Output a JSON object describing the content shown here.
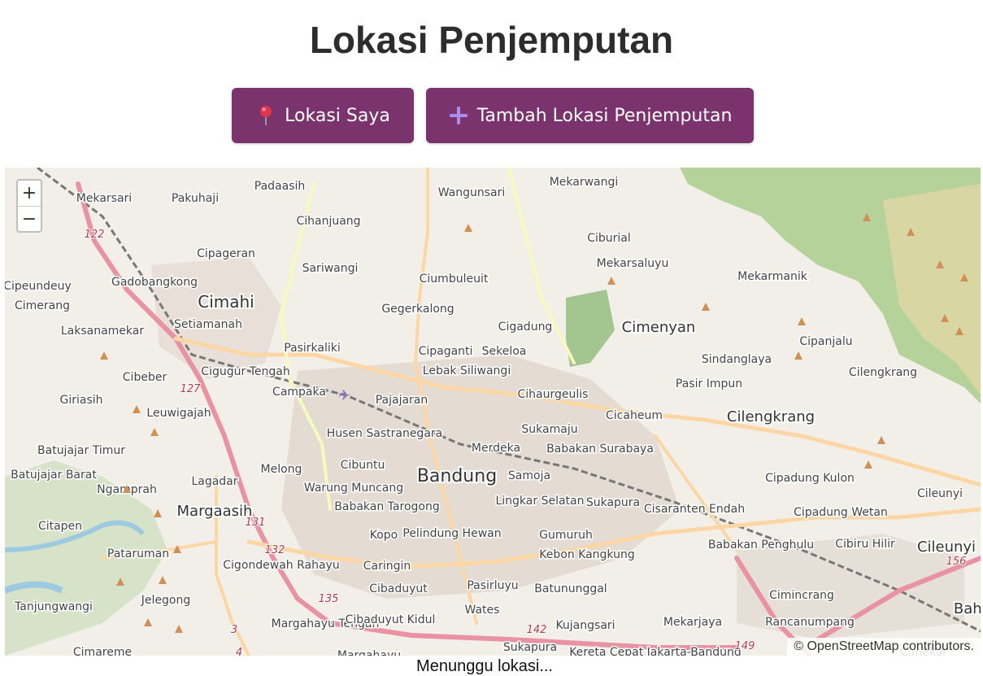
{
  "page": {
    "title": "Lokasi Penjemputan",
    "status_text": "Menunggu lokasi..."
  },
  "buttons": {
    "my_location": {
      "label": "Lokasi Saya",
      "icon": "pin-icon"
    },
    "add_location": {
      "label": "Tambah Lokasi Penjemputan",
      "icon": "plus-icon"
    }
  },
  "colors": {
    "button_bg": "#7b336e",
    "title": "#2d2d2d"
  },
  "map": {
    "zoom_in": "+",
    "zoom_out": "−",
    "attribution": {
      "prefix": "©",
      "link": "OpenStreetMap",
      "suffix": "contributors."
    },
    "places_major": [
      "Bandung",
      "Cimahi",
      "Cimenyan",
      "Margaasih",
      "Cilengkrang",
      "Cileunyi",
      "Bahu"
    ],
    "places": [
      "Mekarsari",
      "Pakuhaji",
      "Padaasih",
      "Wangunsari",
      "Mekarwangi",
      "Cihanjuang",
      "Ciburial",
      "Cipageran",
      "Sariwangi",
      "Mekarsaluyu",
      "Gadobangkong",
      "Ciumbuleuit",
      "Mekarmanik",
      "Cimerang",
      "Setiamanah",
      "Gegerkalong",
      "Laksanamekar",
      "Cigadung",
      "Cipanjalu",
      "Pasirkaliki",
      "Cipaganti",
      "Sekeloa",
      "Sindanglaya",
      "Cigugur Tengah",
      "Lebak Siliwangi",
      "Cibeber",
      "Pasir Impun",
      "Cilengkrang",
      "Giriasih",
      "Campaka",
      "Pajajaran",
      "Cihaurgeulis",
      "Leuwigajah",
      "Cicaheum",
      "Husen Sastranegara",
      "Sukamaju",
      "Batujajar Timur",
      "Merdeka",
      "Babakan Surabaya",
      "Melong",
      "Cibuntu",
      "Samoja",
      "Batujajar Barat",
      "Lagadar",
      "Warung Muncang",
      "Lingkar Selatan",
      "Sukapura",
      "Cipadung Kulon",
      "Babakan Tarogong",
      "Cisaranten Endah",
      "Cipadung Wetan",
      "Citapen",
      "Kopo",
      "Pelindung Hewan",
      "Gumuruh",
      "Caringin",
      "Babakan Penghulu",
      "Cibiru Hilir",
      "Pataruman",
      "Cigondewah Rahayu",
      "Kebon Kangkung",
      "Cibaduyut",
      "Pasirluyu",
      "Batununggal",
      "Jelegong",
      "Cimincrang",
      "Tanjungwangi",
      "Margahayu Tengah",
      "Cibaduyut Kidul",
      "Wates",
      "Mekarjaya",
      "Rancanumpang",
      "Kujangsari",
      "Sukapura",
      "Margahayu",
      "Cileunyi",
      "Kereta Cepat Jakarta-Bandung",
      "Cimekar",
      "Cipeundeuy",
      "Ngamprah",
      "Cimareme"
    ],
    "road_numbers": [
      "122",
      "127",
      "131",
      "132",
      "135",
      "3",
      "4",
      "142",
      "149",
      "156"
    ]
  }
}
